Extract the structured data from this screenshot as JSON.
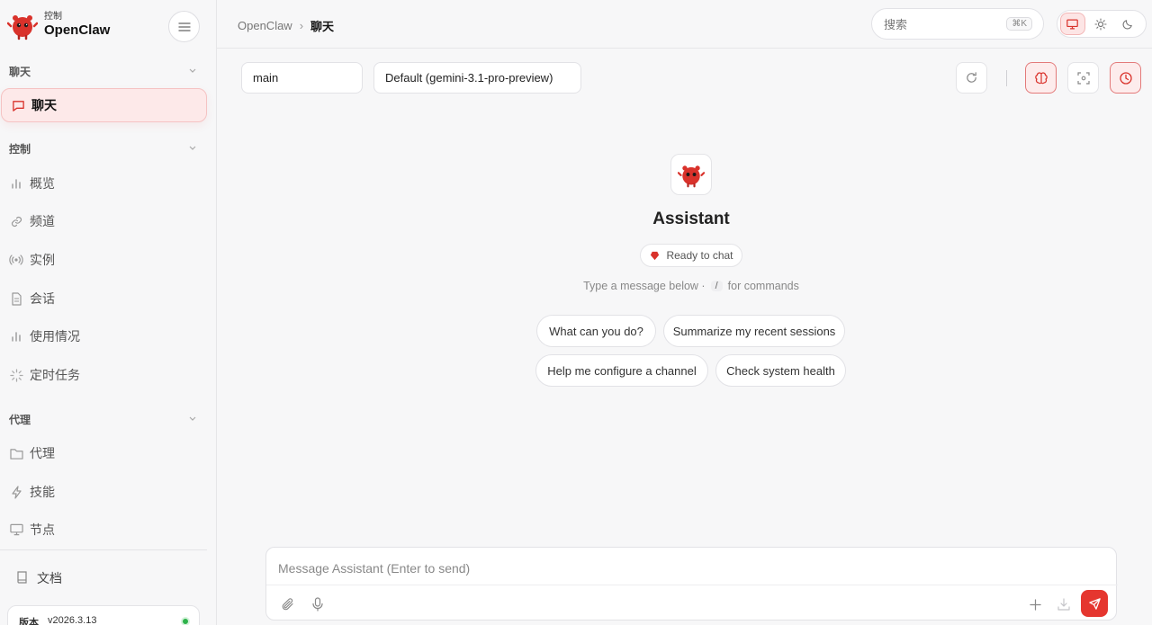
{
  "sidebar": {
    "brand_sub": "控制",
    "brand_name": "OpenClaw",
    "sections": {
      "chat": "聊天",
      "control": "控制",
      "agent": "代理"
    },
    "items": {
      "chat": "聊天",
      "overview": "概览",
      "channels": "频道",
      "instances": "实例",
      "sessions": "会话",
      "usage": "使用情况",
      "cron": "定时任务",
      "agents": "代理",
      "skills": "技能",
      "nodes": "节点"
    },
    "docs": "文档",
    "version_label": "版本",
    "version_value": "v2026.3.13"
  },
  "topbar": {
    "breadcrumb_root": "OpenClaw",
    "breadcrumb_sep": "›",
    "breadcrumb_current": "聊天",
    "search_placeholder": "搜索",
    "search_shortcut": "⌘K"
  },
  "controls": {
    "session_value": "main",
    "model_value": "Default (gemini-3.1-pro-preview)"
  },
  "welcome": {
    "name": "Assistant",
    "status": "Ready to chat",
    "hint_before": "Type a message below ·",
    "hint_key": "/",
    "hint_after": "for commands",
    "suggestions": [
      "What can you do?",
      "Summarize my recent sessions",
      "Help me configure a channel",
      "Check system health"
    ]
  },
  "composer": {
    "placeholder": "Message Assistant (Enter to send)"
  },
  "colors": {
    "accent": "#e5362f",
    "active_bg": "#fde9e9",
    "status_online": "#2db24a"
  }
}
